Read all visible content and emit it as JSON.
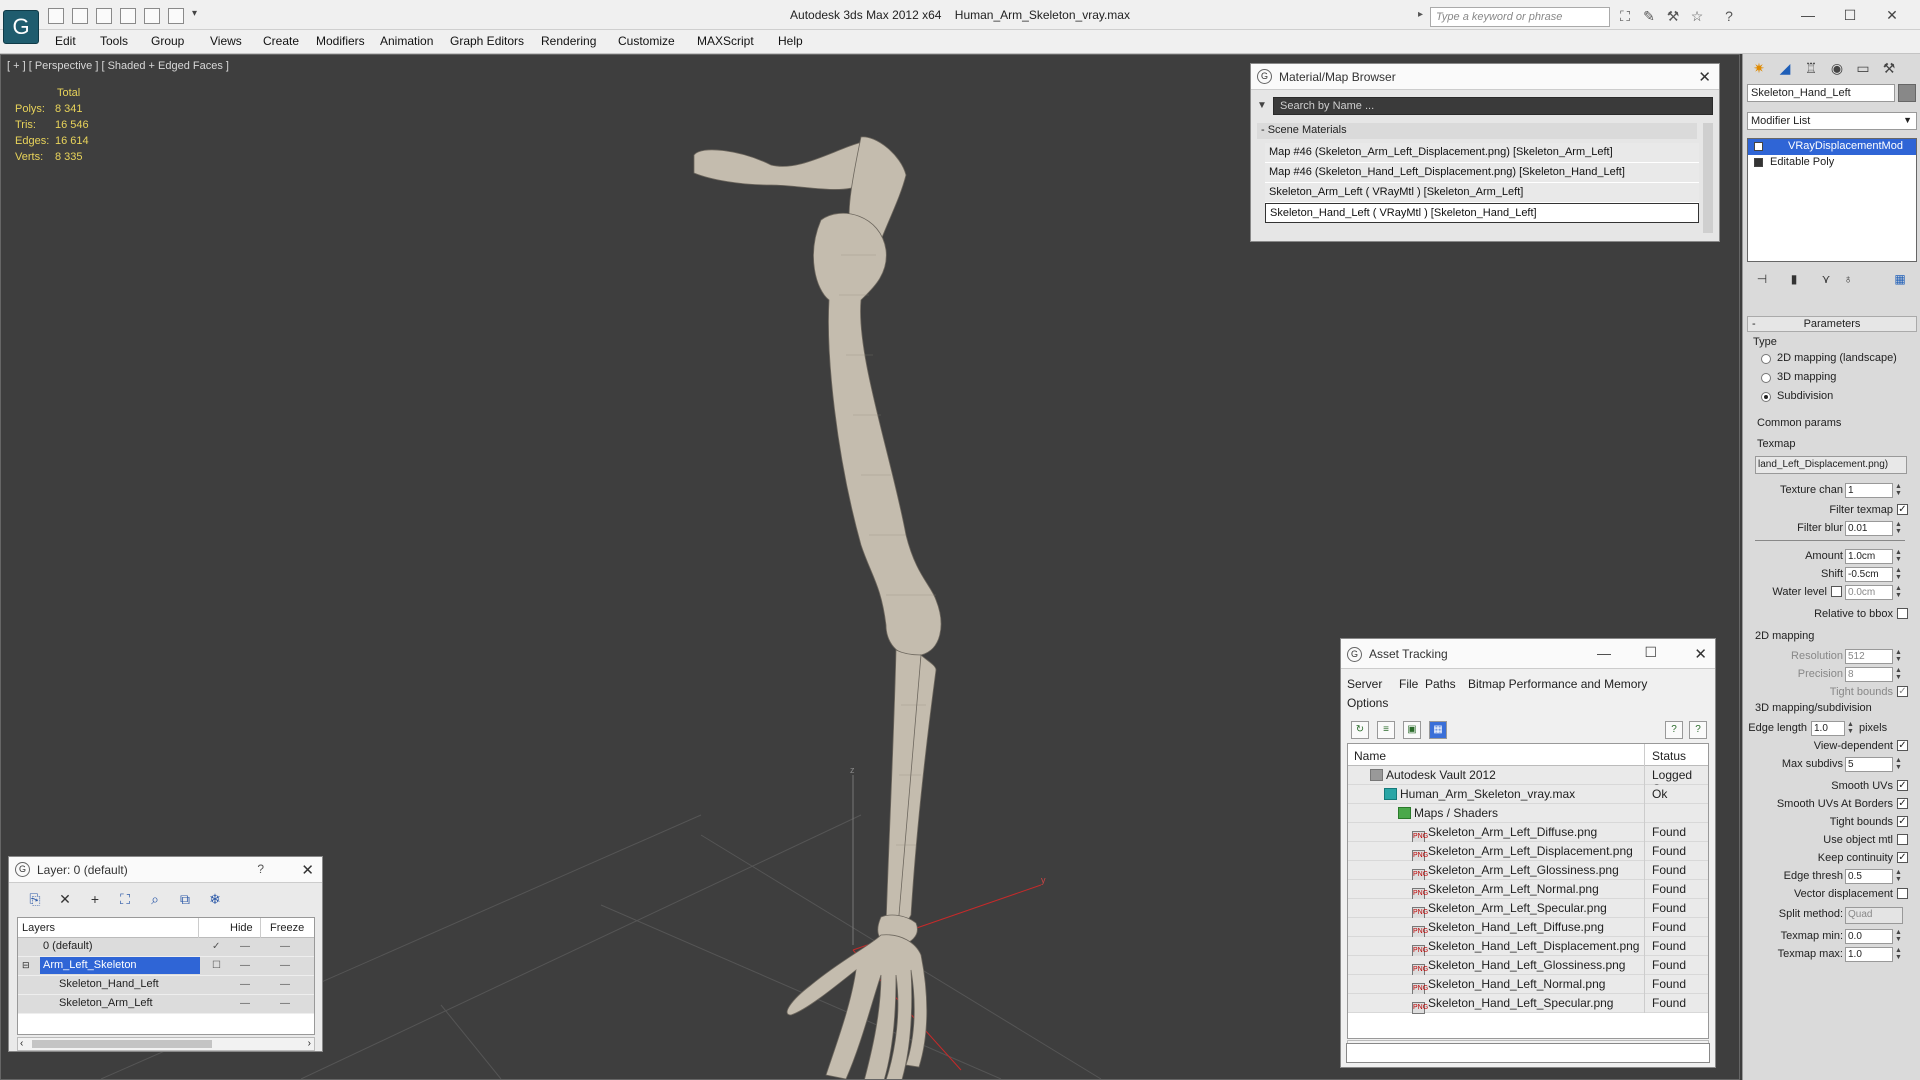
{
  "window": {
    "app_title": "Autodesk 3ds Max  2012 x64",
    "file_name": "Human_Arm_Skeleton_vray.max",
    "search_placeholder": "Type a keyword or phrase"
  },
  "menu": [
    "Edit",
    "Tools",
    "Group",
    "Views",
    "Create",
    "Modifiers",
    "Animation",
    "Graph Editors",
    "Rendering",
    "Customize",
    "MAXScript",
    "Help"
  ],
  "viewport": {
    "label": "[ + ] [ Perspective ] [ Shaded + Edged Faces ]",
    "stats_header": "Total",
    "stats": [
      {
        "k": "Polys:",
        "v": "8 341"
      },
      {
        "k": "Tris:",
        "v": "16 546"
      },
      {
        "k": "Edges:",
        "v": "16 614"
      },
      {
        "k": "Verts:",
        "v": "8 335"
      }
    ],
    "axis_z": "z",
    "axis_y": "y"
  },
  "material_browser": {
    "title": "Material/Map Browser",
    "search_placeholder": "Search by Name ...",
    "group": "- Scene Materials",
    "items": [
      "Map #46 (Skeleton_Arm_Left_Displacement.png) [Skeleton_Arm_Left]",
      "Map #46 (Skeleton_Hand_Left_Displacement.png) [Skeleton_Hand_Left]",
      "Skeleton_Arm_Left  ( VRayMtl )  [Skeleton_Arm_Left]",
      "Skeleton_Hand_Left  ( VRayMtl )  [Skeleton_Hand_Left]"
    ],
    "selected_index": 3
  },
  "asset_tracking": {
    "title": "Asset Tracking",
    "menu": [
      "Server",
      "File",
      "Paths",
      "Bitmap Performance and Memory"
    ],
    "menu2": "Options",
    "col_name": "Name",
    "col_status": "Status",
    "rows": [
      {
        "name": "Autodesk Vault 2012",
        "status": "Logged Out",
        "indent": 0,
        "icon": "vault"
      },
      {
        "name": "Human_Arm_Skeleton_vray.max",
        "status": "Ok",
        "indent": 1,
        "icon": "max"
      },
      {
        "name": "Maps / Shaders",
        "status": "",
        "indent": 2,
        "icon": "folder"
      },
      {
        "name": "Skeleton_Arm_Left_Diffuse.png",
        "status": "Found",
        "indent": 3,
        "icon": "png"
      },
      {
        "name": "Skeleton_Arm_Left_Displacement.png",
        "status": "Found",
        "indent": 3,
        "icon": "png"
      },
      {
        "name": "Skeleton_Arm_Left_Glossiness.png",
        "status": "Found",
        "indent": 3,
        "icon": "png"
      },
      {
        "name": "Skeleton_Arm_Left_Normal.png",
        "status": "Found",
        "indent": 3,
        "icon": "png"
      },
      {
        "name": "Skeleton_Arm_Left_Specular.png",
        "status": "Found",
        "indent": 3,
        "icon": "png"
      },
      {
        "name": "Skeleton_Hand_Left_Diffuse.png",
        "status": "Found",
        "indent": 3,
        "icon": "png"
      },
      {
        "name": "Skeleton_Hand_Left_Displacement.png",
        "status": "Found",
        "indent": 3,
        "icon": "png"
      },
      {
        "name": "Skeleton_Hand_Left_Glossiness.png",
        "status": "Found",
        "indent": 3,
        "icon": "png"
      },
      {
        "name": "Skeleton_Hand_Left_Normal.png",
        "status": "Found",
        "indent": 3,
        "icon": "png"
      },
      {
        "name": "Skeleton_Hand_Left_Specular.png",
        "status": "Found",
        "indent": 3,
        "icon": "png"
      }
    ],
    "png_badge": "PNG"
  },
  "layer_panel": {
    "title": "Layer: 0 (default)",
    "help": "?",
    "col_layers": "Layers",
    "col_hide": "Hide",
    "col_freeze": "Freeze",
    "rows": [
      {
        "name": "0 (default)",
        "indent": 0,
        "selected": false
      },
      {
        "name": "Arm_Left_Skeleton",
        "indent": 0,
        "selected": true
      },
      {
        "name": "Skeleton_Hand_Left",
        "indent": 1,
        "selected": false
      },
      {
        "name": "Skeleton_Arm_Left",
        "indent": 1,
        "selected": false
      }
    ]
  },
  "command_panel": {
    "object_name": "Skeleton_Hand_Left",
    "modifier_list": "Modifier List",
    "stack": [
      "VRayDisplacementMod",
      "Editable Poly"
    ],
    "params_title": "Parameters",
    "type_label": "Type",
    "type_options": [
      "2D mapping (landscape)",
      "3D mapping",
      "Subdivision"
    ],
    "type_selected": 2,
    "common_params": "Common params",
    "texmap_label": "Texmap",
    "texmap_value": "land_Left_Displacement.png)",
    "texture_chan_label": "Texture chan",
    "texture_chan": "1",
    "filter_texmap": "Filter texmap",
    "filter_blur_label": "Filter blur",
    "filter_blur": "0.01",
    "amount_label": "Amount",
    "amount": "1.0cm",
    "shift_label": "Shift",
    "shift": "-0.5cm",
    "water_level_label": "Water level",
    "water_level": "0.0cm",
    "relative_bbox": "Relative to bbox",
    "mapping2d": "2D mapping",
    "resolution_label": "Resolution",
    "resolution": "512",
    "precision_label": "Precision",
    "precision": "8",
    "tight_bounds": "Tight bounds",
    "mapping3d": "3D mapping/subdivision",
    "edge_length_label": "Edge length",
    "edge_length": "1.0",
    "pixels": "pixels",
    "view_dependent": "View-dependent",
    "max_subdivs_label": "Max subdivs",
    "max_subdivs": "5",
    "smooth_uvs": "Smooth UVs",
    "smooth_uvs_borders": "Smooth UVs At Borders",
    "tight_bounds2": "Tight bounds",
    "use_object_mtl": "Use object mtl",
    "keep_continuity": "Keep continuity",
    "edge_thresh_label": "Edge thresh",
    "edge_thresh": "0.5",
    "vector_displacement": "Vector displacement",
    "split_method_label": "Split method:",
    "split_method": "Quad",
    "texmap_min_label": "Texmap min:",
    "texmap_min": "0.0",
    "texmap_max_label": "Texmap max:",
    "texmap_max": "1.0"
  }
}
